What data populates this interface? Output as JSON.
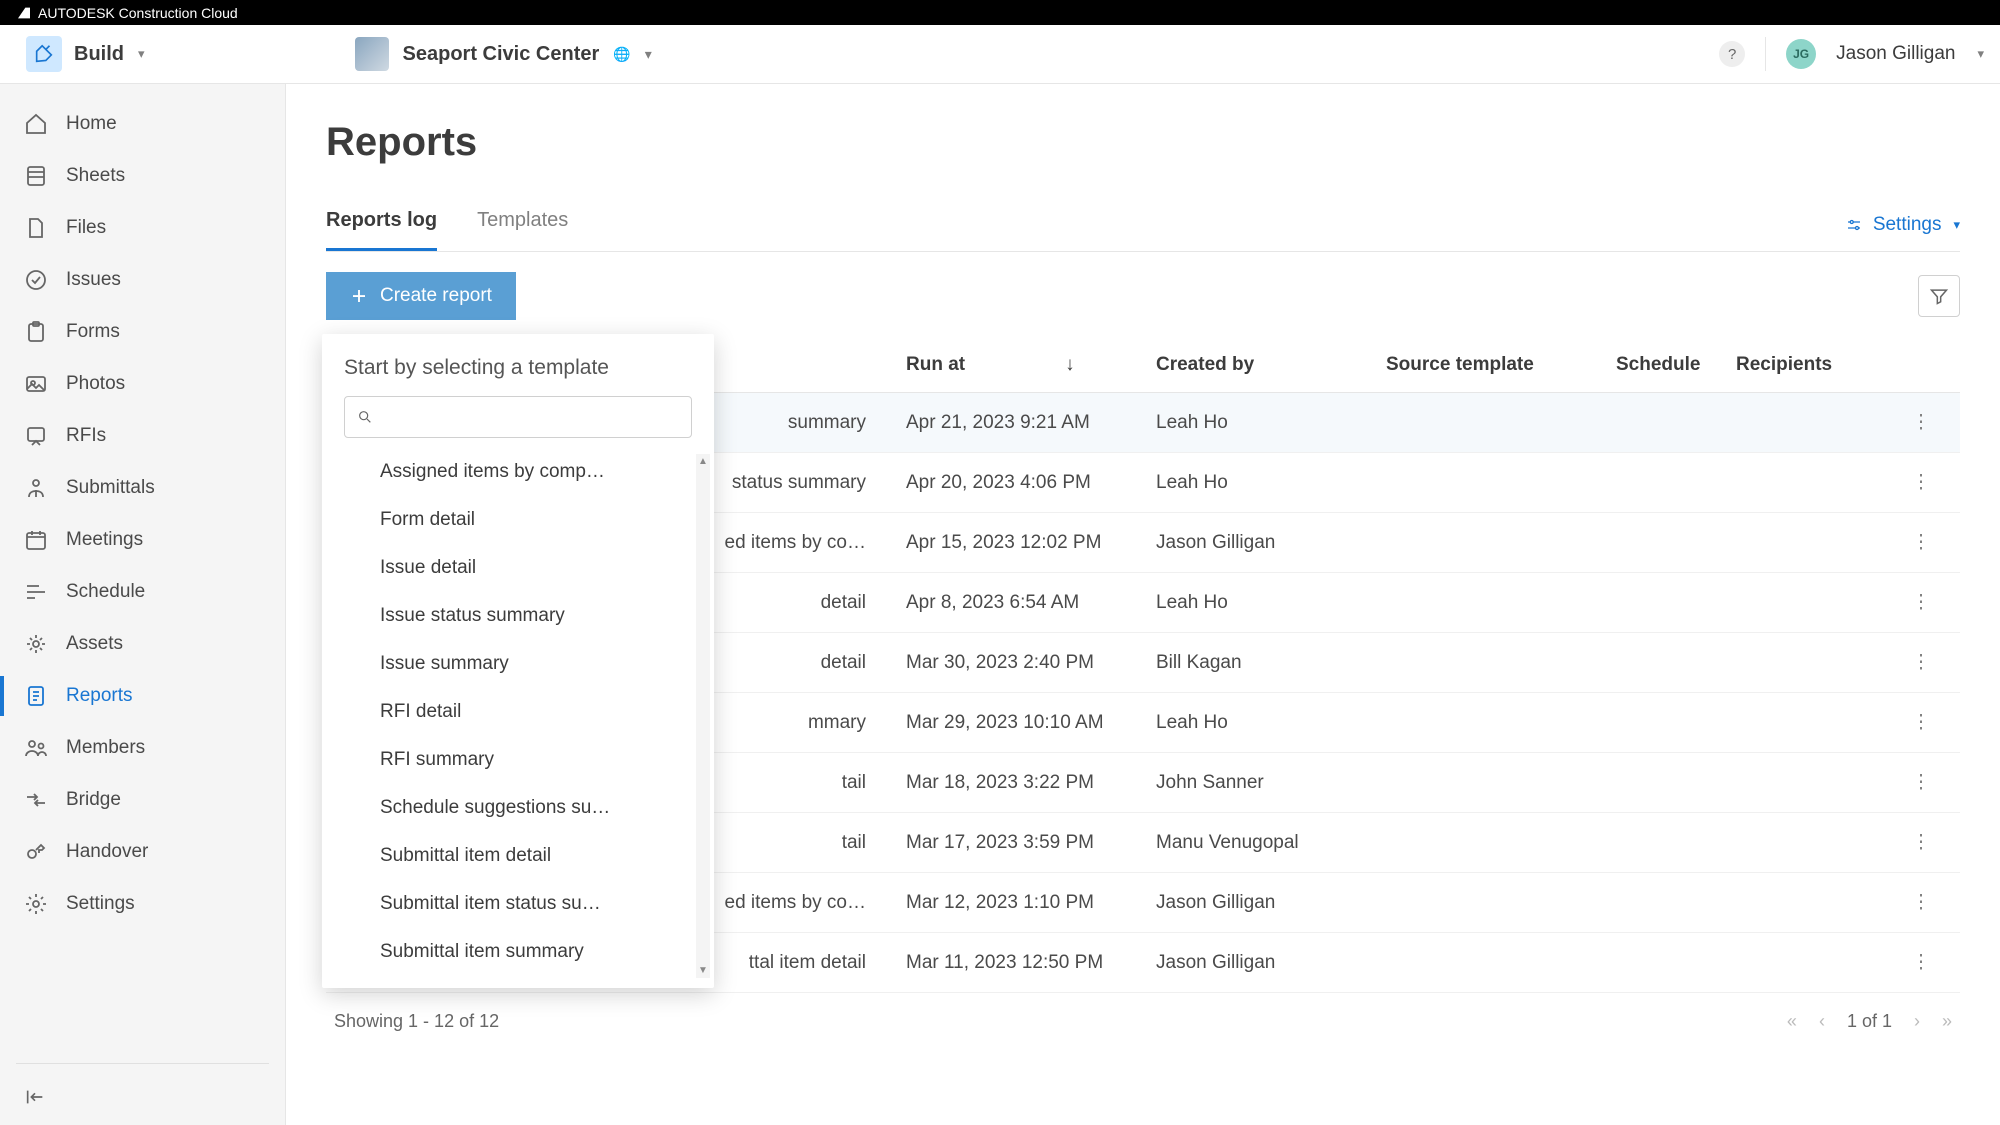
{
  "brand": {
    "suite": "AUTODESK Construction Cloud"
  },
  "product": {
    "name": "Build"
  },
  "project": {
    "name": "Seaport Civic Center"
  },
  "user": {
    "name": "Jason Gilligan",
    "initials": "JG"
  },
  "sidebar": {
    "items": [
      {
        "label": "Home"
      },
      {
        "label": "Sheets"
      },
      {
        "label": "Files"
      },
      {
        "label": "Issues"
      },
      {
        "label": "Forms"
      },
      {
        "label": "Photos"
      },
      {
        "label": "RFIs"
      },
      {
        "label": "Submittals"
      },
      {
        "label": "Meetings"
      },
      {
        "label": "Schedule"
      },
      {
        "label": "Assets"
      },
      {
        "label": "Reports"
      },
      {
        "label": "Members"
      },
      {
        "label": "Bridge"
      },
      {
        "label": "Handover"
      },
      {
        "label": "Settings"
      }
    ]
  },
  "page": {
    "title": "Reports"
  },
  "tabs": {
    "items": [
      "Reports log",
      "Templates"
    ],
    "active": 0
  },
  "settings_link": "Settings",
  "create_button": "Create report",
  "columns": {
    "run_at": "Run at",
    "created_by": "Created by",
    "source_template": "Source template",
    "schedule": "Schedule",
    "recipients": "Recipients"
  },
  "rows": [
    {
      "title_partial": "summary",
      "run_at": "Apr 21, 2023 9:21 AM",
      "created_by": "Leah Ho"
    },
    {
      "title_partial": "status summary",
      "run_at": "Apr 20, 2023 4:06 PM",
      "created_by": "Leah Ho"
    },
    {
      "title_partial": "ed items by co…",
      "run_at": "Apr 15, 2023 12:02 PM",
      "created_by": "Jason Gilligan"
    },
    {
      "title_partial": "detail",
      "run_at": "Apr 8, 2023 6:54 AM",
      "created_by": "Leah Ho"
    },
    {
      "title_partial": "detail",
      "run_at": "Mar 30, 2023 2:40 PM",
      "created_by": "Bill Kagan"
    },
    {
      "title_partial": "mmary",
      "run_at": "Mar 29, 2023 10:10 AM",
      "created_by": "Leah Ho"
    },
    {
      "title_partial": "tail",
      "run_at": "Mar 18, 2023 3:22 PM",
      "created_by": "John Sanner"
    },
    {
      "title_partial": "tail",
      "run_at": "Mar 17, 2023 3:59 PM",
      "created_by": "Manu Venugopal"
    },
    {
      "title_partial": "ed items by co…",
      "run_at": "Mar 12, 2023 1:10 PM",
      "created_by": "Jason Gilligan"
    },
    {
      "title_partial": "ttal item detail",
      "run_at": "Mar 11, 2023 12:50 PM",
      "created_by": "Jason Gilligan"
    }
  ],
  "dropdown": {
    "title": "Start by selecting a template",
    "items": [
      "Assigned items by comp…",
      "Form detail",
      "Issue detail",
      "Issue status summary",
      "Issue summary",
      "RFI detail",
      "RFI summary",
      "Schedule suggestions su…",
      "Submittal item detail",
      "Submittal item status su…",
      "Submittal item summary"
    ]
  },
  "footer": {
    "showing": "Showing 1 - 12 of 12",
    "page": "1 of 1"
  }
}
